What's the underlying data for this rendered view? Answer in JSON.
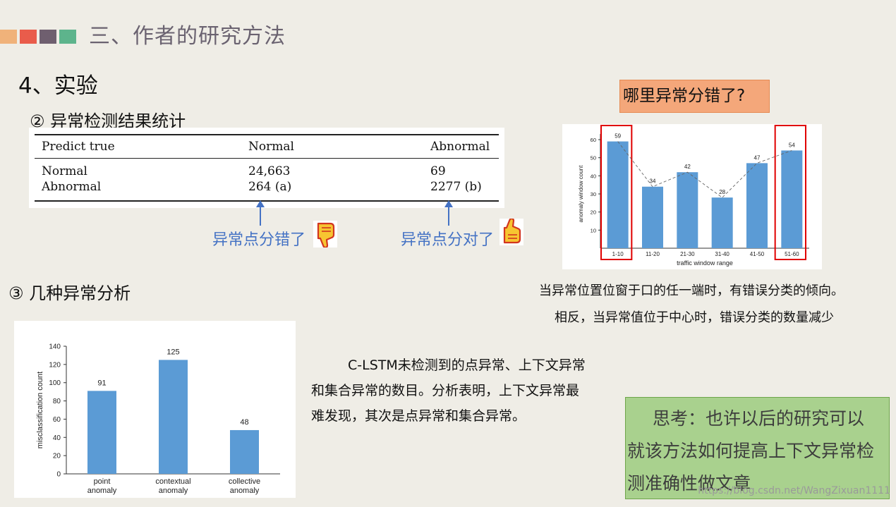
{
  "header": {
    "title": "三、作者的研究方法",
    "squares": [
      "#f0b27a",
      "#e95c4b",
      "#6f5f6f",
      "#5db48c"
    ]
  },
  "section": "4、实验",
  "sub2": "② 异常检测结果统计",
  "sub3": "③ 几种异常分析",
  "table": {
    "headers": [
      "Predict true",
      "Normal",
      "Abnormal"
    ],
    "rows": [
      [
        "Normal",
        "24,663",
        "69"
      ],
      [
        "Abnormal",
        "264 (a)",
        "2277 (b)"
      ]
    ]
  },
  "annotations": {
    "wrong": "异常点分错了",
    "right": "异常点分对了"
  },
  "callout": "哪里异常分错了?",
  "window_chart_note": [
    "当异常位置位窗于口的任一端时，有错误分类的倾向。",
    "相反，当异常值位于中心时，错误分类的数量减少"
  ],
  "paragraph": [
    "C-LSTM未检测到的点异常、上下文异常",
    "和集合异常的数目。分析表明，上下文异常最",
    "难发现，其次是点异常和集合异常。"
  ],
  "think": [
    "思考：也许以后的研究可以",
    "就该方法如何提高上下文异常检",
    "测准确性做文章"
  ],
  "watermark": "https://blog.csdn.net/WangZixuan1111",
  "chart_data": [
    {
      "type": "bar",
      "categories": [
        "1-10",
        "11-20",
        "21-30",
        "31-40",
        "41-50",
        "51-60"
      ],
      "values": [
        59,
        34,
        42,
        28,
        47,
        54
      ],
      "xlabel": "traffic window range",
      "ylabel": "anomaly window count",
      "ylim": [
        0,
        60
      ],
      "yticks": [
        10,
        20,
        30,
        40,
        50,
        60
      ],
      "highlighted": [
        "1-10",
        "51-60"
      ],
      "bar_color": "#5b9bd5",
      "highlight_color": "#e00000"
    },
    {
      "type": "bar",
      "categories": [
        "point\nanomaly",
        "contextual\nanomaly",
        "collective\nanomaly"
      ],
      "values": [
        91,
        125,
        48
      ],
      "xlabel": "",
      "ylabel": "misclassification count",
      "ylim": [
        0,
        140
      ],
      "yticks": [
        0,
        20,
        40,
        60,
        80,
        100,
        120,
        140
      ],
      "bar_color": "#5b9bd5"
    }
  ]
}
